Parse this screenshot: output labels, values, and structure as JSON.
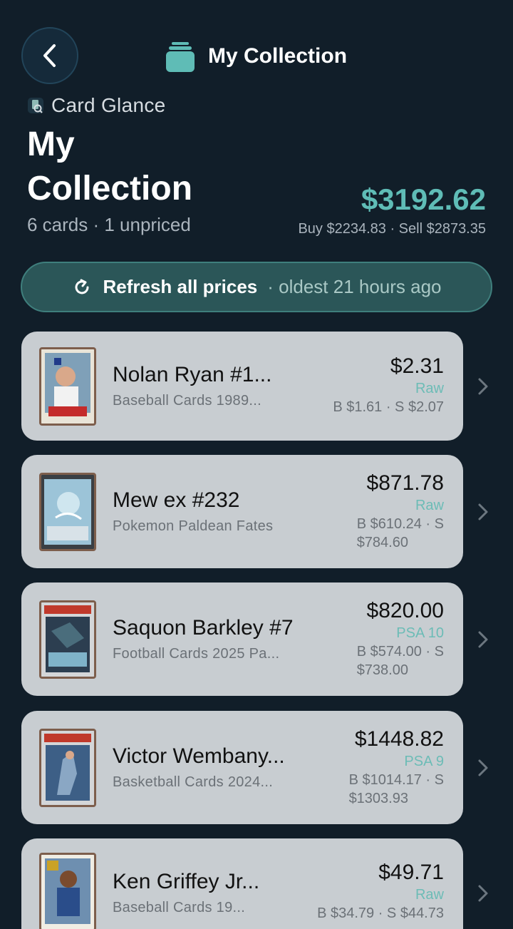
{
  "nav": {
    "back_icon": "chevron-left-icon",
    "title": "My Collection",
    "title_icon": "card-stack-icon"
  },
  "brand": {
    "name": "Card Glance",
    "icon": "card-glance-logo-icon"
  },
  "header": {
    "title": "My Collection",
    "summary": "6 cards · 1 unpriced",
    "total": "$3192.62",
    "buy_sell": "Buy $2234.83 · Sell $2873.35"
  },
  "refresh": {
    "label": "Refresh all prices",
    "age": "· oldest 21 hours ago",
    "icon": "refresh-icon"
  },
  "cards": [
    {
      "name": "Nolan Ryan #1...",
      "set": "Baseball Cards 1989...",
      "price": "$2.31",
      "grade": "Raw",
      "bs1": "B $1.61 · S $2.07",
      "bs2": ""
    },
    {
      "name": "Mew ex #232",
      "set": "Pokemon Paldean Fates",
      "price": "$871.78",
      "grade": "Raw",
      "bs1": "B $610.24 · S",
      "bs2": "$784.60"
    },
    {
      "name": "Saquon Barkley #7",
      "set": "Football Cards 2025 Pa...",
      "price": "$820.00",
      "grade": "PSA 10",
      "bs1": "B $574.00 · S",
      "bs2": "$738.00"
    },
    {
      "name": "Victor Wembany...",
      "set": "Basketball Cards 2024...",
      "price": "$1448.82",
      "grade": "PSA 9",
      "bs1": "B $1014.17 · S",
      "bs2": "$1303.93"
    },
    {
      "name": "Ken Griffey Jr...",
      "set": "Baseball Cards 19...",
      "price": "$49.71",
      "grade": "Raw",
      "bs1": "B $34.79 · S $44.73",
      "bs2": ""
    }
  ],
  "colors": {
    "background": "#111e29",
    "accent": "#5fbcb6",
    "row": "#c8cdd1",
    "refresh_bg": "#2b5658"
  }
}
